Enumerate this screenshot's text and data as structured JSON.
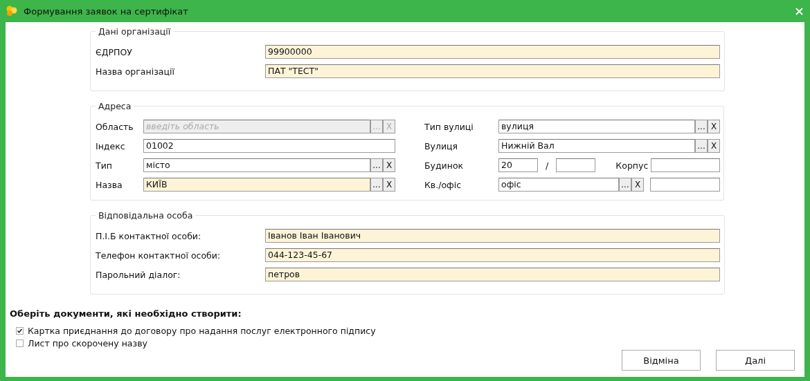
{
  "window": {
    "title": "Формування заявок на сертифікат"
  },
  "organization": {
    "title": "Дані організації",
    "fields": [
      {
        "label": "ЄДРПОУ",
        "value": "99900000",
        "highlighted": true
      },
      {
        "label": "Назва організації",
        "value": "ПАТ \"ТЕСТ\"",
        "highlighted": true
      }
    ]
  },
  "address": {
    "title": "Адреса",
    "left": [
      {
        "label": "Область",
        "kind": "lookup",
        "placeholder": "введіть область",
        "disabled": true,
        "highlighted": false,
        "buttons": [
          "...",
          "X"
        ]
      },
      {
        "label": "Індекс",
        "kind": "text",
        "value": "01002",
        "disabled": false,
        "highlighted": false
      },
      {
        "label": "Тип",
        "kind": "lookup",
        "value": "місто",
        "disabled": false,
        "highlighted": false,
        "buttons": [
          "...",
          "X"
        ]
      },
      {
        "label": "Назва",
        "kind": "lookup",
        "value": "КИЇВ",
        "disabled": false,
        "highlighted": true,
        "buttons": [
          "...",
          "X"
        ]
      }
    ],
    "right": [
      {
        "label": "Тип вулиці",
        "kind": "lookup",
        "value": "вулиця",
        "buttons": [
          "...",
          "X"
        ]
      },
      {
        "label": "Вулиця",
        "kind": "lookup",
        "value": "Нижній Вал",
        "buttons": [
          "...",
          "X"
        ]
      },
      {
        "label": "Будинок",
        "kind": "house",
        "value": "20",
        "separator": "/",
        "extra_label": "Корпус"
      },
      {
        "label": "Кв./офіс",
        "kind": "apartment",
        "value": "офіс",
        "buttons": [
          "...",
          "X"
        ]
      }
    ]
  },
  "contact": {
    "title": "Відповідальна особа",
    "fields": [
      {
        "label": "П.І.Б контактної особи:",
        "value": "Іванов Іван Іванович",
        "highlighted": true
      },
      {
        "label": "Телефон контактної особи:",
        "value": "044-123-45-67",
        "highlighted": true
      },
      {
        "label": "Парольний діалог:",
        "value": "петров",
        "highlighted": true
      }
    ]
  },
  "documents": {
    "title": "Оберіть документи, які необхідно створити:",
    "items": [
      {
        "label": "Картка приєднання до договору про надання послуг електронного підпису",
        "checked": true
      },
      {
        "label": "Лист про скорочену назву",
        "checked": false
      }
    ]
  },
  "buttons": [
    "Відміна",
    "Далі"
  ]
}
